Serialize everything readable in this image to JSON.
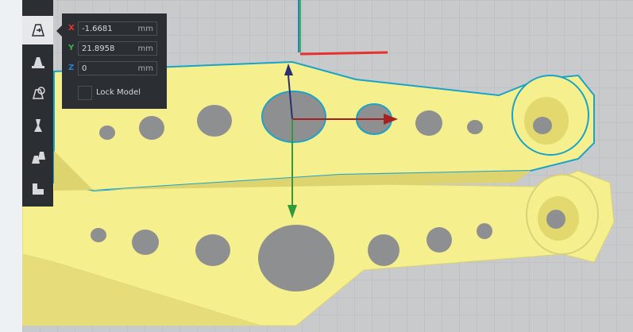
{
  "toolbar": {
    "tools": [
      {
        "name": "move-tool",
        "active": true
      },
      {
        "name": "scale-tool",
        "active": false
      },
      {
        "name": "rotate-tool",
        "active": false
      },
      {
        "name": "mirror-tool",
        "active": false
      },
      {
        "name": "per-model-settings-tool",
        "active": false
      },
      {
        "name": "support-blocker-tool",
        "active": false
      }
    ]
  },
  "move_panel": {
    "x": {
      "axis": "X",
      "value": "-1.6681",
      "unit": "mm",
      "color": "#e8312f"
    },
    "y": {
      "axis": "Y",
      "value": "21.8958",
      "unit": "mm",
      "color": "#3cb54a"
    },
    "z": {
      "axis": "Z",
      "value": "0",
      "unit": "mm",
      "color": "#2c7fcf"
    },
    "lock_model_label": "Lock Model",
    "lock_model_checked": false
  },
  "colors": {
    "model": "#f6ef8e",
    "outline": "#1aa3c9",
    "panel_bg": "#2b2f33",
    "grid": "#c9cacc"
  }
}
